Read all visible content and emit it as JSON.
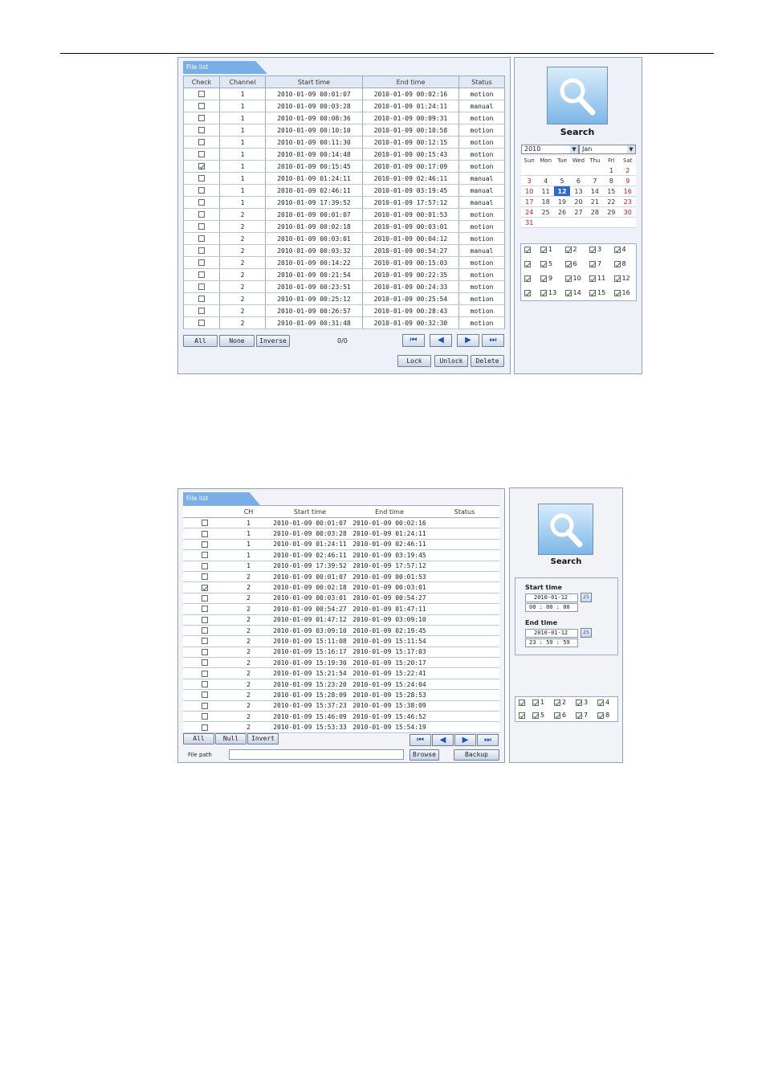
{
  "top": {
    "tab_label": "File list",
    "columns": [
      "Check",
      "Channel",
      "Start time",
      "End time",
      "Status"
    ],
    "rows": [
      {
        "checked": false,
        "channel": "1",
        "start": "2010-01-09 00:01:07",
        "end": "2010-01-09 00:02:16",
        "status": "motion"
      },
      {
        "checked": false,
        "channel": "1",
        "start": "2010-01-09 00:03:28",
        "end": "2010-01-09 01:24:11",
        "status": "manual"
      },
      {
        "checked": false,
        "channel": "1",
        "start": "2010-01-09 00:08:36",
        "end": "2010-01-09 00:09:31",
        "status": "motion"
      },
      {
        "checked": false,
        "channel": "1",
        "start": "2010-01-09 00:10:10",
        "end": "2010-01-09 00:10:58",
        "status": "motion"
      },
      {
        "checked": false,
        "channel": "1",
        "start": "2010-01-09 00:11:30",
        "end": "2010-01-09 00:12:15",
        "status": "motion"
      },
      {
        "checked": false,
        "channel": "1",
        "start": "2010-01-09 00:14:48",
        "end": "2010-01-09 00:15:43",
        "status": "motion"
      },
      {
        "checked": true,
        "channel": "1",
        "start": "2010-01-09 00:15:45",
        "end": "2010-01-09 00:17:09",
        "status": "motion"
      },
      {
        "checked": false,
        "channel": "1",
        "start": "2010-01-09 01:24:11",
        "end": "2010-01-09 02:46:11",
        "status": "manual"
      },
      {
        "checked": false,
        "channel": "1",
        "start": "2010-01-09 02:46:11",
        "end": "2010-01-09 03:19:45",
        "status": "manual"
      },
      {
        "checked": false,
        "channel": "1",
        "start": "2010-01-09 17:39:52",
        "end": "2010-01-09 17:57:12",
        "status": "manual"
      },
      {
        "checked": false,
        "channel": "2",
        "start": "2010-01-09 00:01:07",
        "end": "2010-01-09 00:01:53",
        "status": "motion"
      },
      {
        "checked": false,
        "channel": "2",
        "start": "2010-01-09 00:02:18",
        "end": "2010-01-09 00:03:01",
        "status": "motion"
      },
      {
        "checked": false,
        "channel": "2",
        "start": "2010-01-09 00:03:01",
        "end": "2010-01-09 00:04:12",
        "status": "motion"
      },
      {
        "checked": false,
        "channel": "2",
        "start": "2010-01-09 00:03:32",
        "end": "2010-01-09 00:54:27",
        "status": "manual"
      },
      {
        "checked": false,
        "channel": "2",
        "start": "2010-01-09 00:14:22",
        "end": "2010-01-09 00:15:03",
        "status": "motion"
      },
      {
        "checked": false,
        "channel": "2",
        "start": "2010-01-09 00:21:54",
        "end": "2010-01-09 00:22:35",
        "status": "motion"
      },
      {
        "checked": false,
        "channel": "2",
        "start": "2010-01-09 00:23:51",
        "end": "2010-01-09 00:24:33",
        "status": "motion"
      },
      {
        "checked": false,
        "channel": "2",
        "start": "2010-01-09 00:25:12",
        "end": "2010-01-09 00:25:54",
        "status": "motion"
      },
      {
        "checked": false,
        "channel": "2",
        "start": "2010-01-09 00:26:57",
        "end": "2010-01-09 00:28:43",
        "status": "motion"
      },
      {
        "checked": false,
        "channel": "2",
        "start": "2010-01-09 00:31:48",
        "end": "2010-01-09 00:32:30",
        "status": "motion"
      }
    ],
    "buttons": {
      "all": "All",
      "none": "None",
      "inverse": "Inverse",
      "lock": "Lock",
      "unlock": "Unlock",
      "delete": "Delete"
    },
    "page_counter": "0/0",
    "search_label": "Search",
    "year": "2010",
    "month": "Jan",
    "weekdays": [
      "Sun",
      "Mon",
      "Tue",
      "Wed",
      "Thu",
      "Fri",
      "Sat"
    ],
    "calendar_weeks": [
      [
        "",
        "",
        "",
        "",
        "",
        "1",
        "2"
      ],
      [
        "3",
        "4",
        "5",
        "6",
        "7",
        "8",
        "9"
      ],
      [
        "10",
        "11",
        "12",
        "13",
        "14",
        "15",
        "16"
      ],
      [
        "17",
        "18",
        "19",
        "20",
        "21",
        "22",
        "23"
      ],
      [
        "24",
        "25",
        "26",
        "27",
        "28",
        "29",
        "30"
      ],
      [
        "31",
        "",
        "",
        "",
        "",
        "",
        ""
      ]
    ],
    "selected_day": "12",
    "channels": [
      "1",
      "2",
      "3",
      "4",
      "5",
      "6",
      "7",
      "8",
      "9",
      "10",
      "11",
      "12",
      "13",
      "14",
      "15",
      "16"
    ]
  },
  "bottom": {
    "tab_label": "File list",
    "columns": [
      "",
      "CH",
      "Start time",
      "End time",
      "Status"
    ],
    "rows": [
      {
        "checked": false,
        "channel": "1",
        "start": "2010-01-09 00:01:07",
        "end": "2010-01-09 00:02:16"
      },
      {
        "checked": false,
        "channel": "1",
        "start": "2010-01-09 00:03:28",
        "end": "2010-01-09 01:24:11"
      },
      {
        "checked": false,
        "channel": "1",
        "start": "2010-01-09 01:24:11",
        "end": "2010-01-09 02:46:11"
      },
      {
        "checked": false,
        "channel": "1",
        "start": "2010-01-09 02:46:11",
        "end": "2010-01-09 03:19:45"
      },
      {
        "checked": false,
        "channel": "1",
        "start": "2010-01-09 17:39:52",
        "end": "2010-01-09 17:57:12"
      },
      {
        "checked": false,
        "channel": "2",
        "start": "2010-01-09 00:01:07",
        "end": "2010-01-09 00:01:53"
      },
      {
        "checked": true,
        "channel": "2",
        "start": "2010-01-09 00:02:18",
        "end": "2010-01-09 00:03:01"
      },
      {
        "checked": false,
        "channel": "2",
        "start": "2010-01-09 00:03:01",
        "end": "2010-01-09 00:54:27"
      },
      {
        "checked": false,
        "channel": "2",
        "start": "2010-01-09 00:54:27",
        "end": "2010-01-09 01:47:11"
      },
      {
        "checked": false,
        "channel": "2",
        "start": "2010-01-09 01:47:12",
        "end": "2010-01-09 03:09:10"
      },
      {
        "checked": false,
        "channel": "2",
        "start": "2010-01-09 03:09:10",
        "end": "2010-01-09 02:19:45"
      },
      {
        "checked": false,
        "channel": "2",
        "start": "2010-01-09 15:11:08",
        "end": "2010-01-09 15:11:54"
      },
      {
        "checked": false,
        "channel": "2",
        "start": "2010-01-09 15:16:17",
        "end": "2010-01-09 15:17:03"
      },
      {
        "checked": false,
        "channel": "2",
        "start": "2010-01-09 15:19:30",
        "end": "2010-01-09 15:20:17"
      },
      {
        "checked": false,
        "channel": "2",
        "start": "2010-01-09 15:21:54",
        "end": "2010-01-09 15:22:41"
      },
      {
        "checked": false,
        "channel": "2",
        "start": "2010-01-09 15:23:20",
        "end": "2010-01-09 15:24:04"
      },
      {
        "checked": false,
        "channel": "2",
        "start": "2010-01-09 15:28:09",
        "end": "2010-01-09 15:28:53"
      },
      {
        "checked": false,
        "channel": "2",
        "start": "2010-01-09 15:37:23",
        "end": "2010-01-09 15:38:09"
      },
      {
        "checked": false,
        "channel": "2",
        "start": "2010-01-09 15:46:09",
        "end": "2010-01-09 15:46:52"
      },
      {
        "checked": false,
        "channel": "2",
        "start": "2010-01-09 15:53:33",
        "end": "2010-01-09 15:54:19"
      }
    ],
    "buttons": {
      "all": "All",
      "null": "Null",
      "invert": "Invert",
      "browse": "Browse",
      "backup": "Backup"
    },
    "file_path_label": "File path",
    "file_path_value": "",
    "search_label": "Search",
    "start_time_label": "Start time",
    "start_date": "2010-01-12",
    "start_h": "00",
    "start_m": "00",
    "start_s": "00",
    "end_time_label": "End time",
    "end_date": "2010-01-12",
    "end_h": "23",
    "end_m": "59",
    "end_s": "59",
    "cal_icon_text": "25",
    "channels": [
      "1",
      "2",
      "3",
      "4",
      "5",
      "6",
      "7",
      "8"
    ]
  }
}
